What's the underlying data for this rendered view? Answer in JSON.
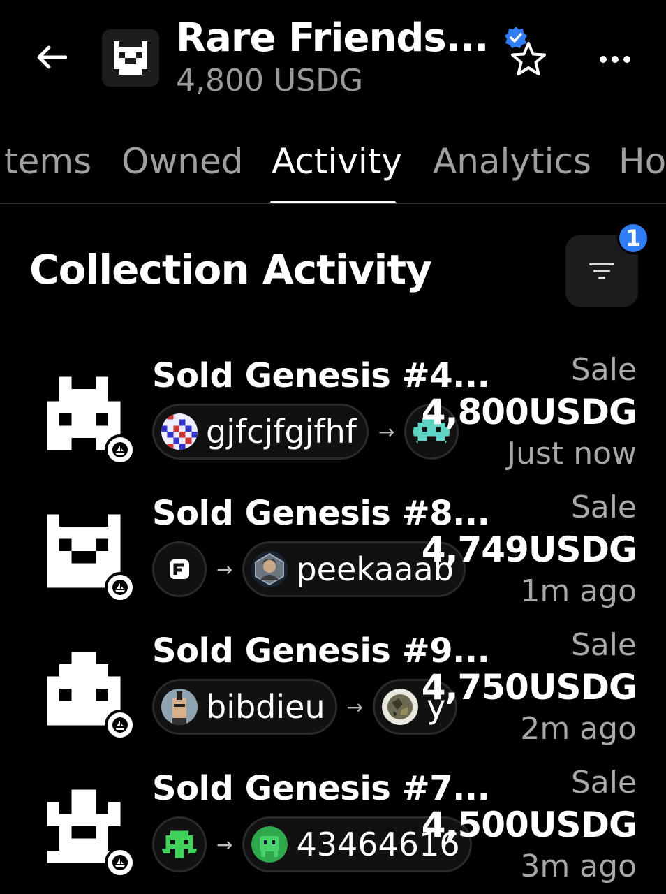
{
  "header": {
    "title": "Rare Friends...",
    "subtitle": "4,800 USDG"
  },
  "tabs": [
    {
      "label": "tems",
      "active": false
    },
    {
      "label": "Owned",
      "active": false
    },
    {
      "label": "Activity",
      "active": true
    },
    {
      "label": "Analytics",
      "active": false
    },
    {
      "label": "Ho",
      "active": false
    }
  ],
  "section": {
    "title": "Collection Activity",
    "filter_count": "1"
  },
  "colors": {
    "accent_blue": "#2f7ef5",
    "muted_text": "#a8a8a8",
    "background": "#000000"
  },
  "activity": [
    {
      "title": "Sold Genesis #4...",
      "from": {
        "label": "gjfcjfgjfhf",
        "avatar_icon": "checker-avatar"
      },
      "to": {
        "label": "",
        "avatar_icon": "teal-invader-avatar"
      },
      "kind": "Sale",
      "price": "4,800USDG",
      "time": "Just now",
      "thumb_icon": "pixel-creature-1"
    },
    {
      "title": "Sold Genesis #8...",
      "from": {
        "label": "",
        "avatar_icon": "f-logo-avatar"
      },
      "to": {
        "label": "peekaaab",
        "avatar_icon": "portrait-avatar"
      },
      "kind": "Sale",
      "price": "4,749USDG",
      "time": "1m ago",
      "thumb_icon": "pixel-creature-2"
    },
    {
      "title": "Sold Genesis #9...",
      "from": {
        "label": "bibdieu",
        "avatar_icon": "punk-avatar"
      },
      "to": {
        "label": "y",
        "avatar_icon": "camo-avatar"
      },
      "kind": "Sale",
      "price": "4,750USDG",
      "time": "2m ago",
      "thumb_icon": "pixel-creature-3"
    },
    {
      "title": "Sold Genesis #7...",
      "from": {
        "label": "",
        "avatar_icon": "green-invader-avatar"
      },
      "to": {
        "label": "43464616",
        "avatar_icon": "green-blob-avatar"
      },
      "kind": "Sale",
      "price": "4,500USDG",
      "time": "3m ago",
      "thumb_icon": "pixel-creature-4"
    }
  ]
}
